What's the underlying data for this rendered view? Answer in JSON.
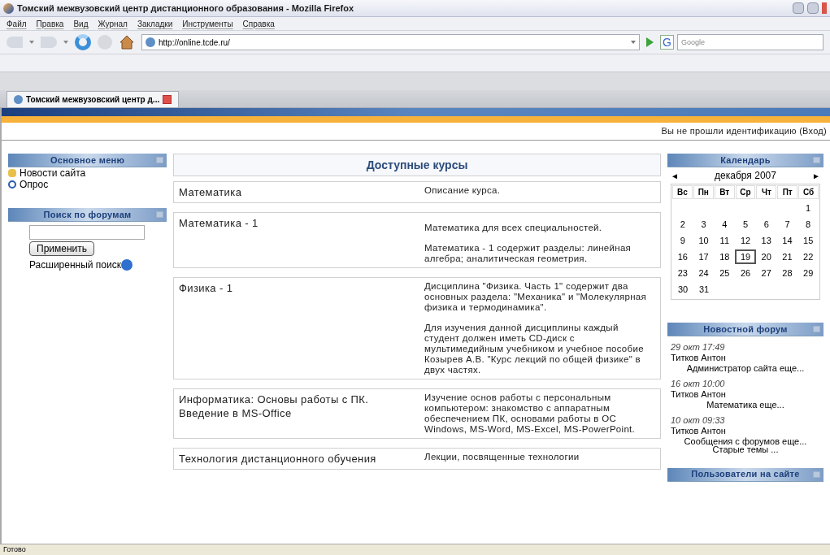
{
  "window": {
    "title": "Томский межвузовский центр дистанционного образования - Mozilla Firefox"
  },
  "menu": [
    "Файл",
    "Правка",
    "Вид",
    "Журнал",
    "Закладки",
    "Инструменты",
    "Справка"
  ],
  "address": {
    "value": "http://online.tcde.ru/"
  },
  "search": {
    "engine": "G",
    "placeholder": "Google"
  },
  "tabs": [
    {
      "label": "Томский межвузовский центр д...",
      "selected": true
    }
  ],
  "login_text": "Вы не прошли идентификацию (Вход)",
  "main_menu": {
    "title": "Основное меню",
    "items": [
      {
        "label": "Новости сайта",
        "kind": "news"
      },
      {
        "label": "Опрос",
        "kind": "poll"
      }
    ]
  },
  "forum_search": {
    "title": "Поиск по форумам",
    "button": "Применить",
    "advanced": "Расширенный поиск"
  },
  "courses": {
    "title": "Доступные курсы",
    "rows": [
      {
        "name": "Математика",
        "description": [
          "Описание курса."
        ]
      },
      {
        "name": "Математика - 1",
        "description": [
          "Математика для всех специальностей.",
          "Математика - 1 содержит разделы: линейная алгебра; аналитическая геометрия."
        ]
      },
      {
        "name": "Физика - 1",
        "description": [
          "Дисциплина \"Физика. Часть 1\" содержит два основных раздела: \"Механика\" и \"Молекулярная физика и термодинамика\".",
          "Для изучения данной дисциплины каждый студент должен иметь CD-диск с мультимедийным учебником и учебное пособие Козырев А.В. \"Курс лекций по общей физике\" в двух частях."
        ]
      },
      {
        "name": "Информатика: Основы работы с ПК. Введение в MS-Office",
        "description": [
          "Изучение основ работы с персональным компьютером: знакомство с аппаратным обеспечением ПК, основами работы в ОС Windows, MS-Word, MS-Excel, MS-PowerPoint."
        ]
      },
      {
        "name": "Технология дистанционного обучения",
        "description": [
          "Лекции, посвященные технологии"
        ]
      }
    ]
  },
  "calendar": {
    "title": "Календарь",
    "prev": "◄",
    "next": "►",
    "month": "декабря 2007",
    "weekdays": [
      "Вс",
      "Пн",
      "Вт",
      "Ср",
      "Чт",
      "Пт",
      "Сб"
    ],
    "weeks": [
      {
        "kind": "partial",
        "days": [
          {
            "day": "1",
            "today": false
          }
        ]
      },
      {
        "kind": "full",
        "days": [
          {
            "day": "2",
            "today": false
          },
          {
            "day": "3",
            "today": false
          },
          {
            "day": "4",
            "today": false
          },
          {
            "day": "5",
            "today": false
          },
          {
            "day": "6",
            "today": false
          },
          {
            "day": "7",
            "today": false
          },
          {
            "day": "8",
            "today": false
          }
        ]
      },
      {
        "kind": "full",
        "days": [
          {
            "day": "9",
            "today": false
          },
          {
            "day": "10",
            "today": false
          },
          {
            "day": "11",
            "today": false
          },
          {
            "day": "12",
            "today": false
          },
          {
            "day": "13",
            "today": false
          },
          {
            "day": "14",
            "today": false
          },
          {
            "day": "15",
            "today": false
          }
        ]
      },
      {
        "kind": "full",
        "days": [
          {
            "day": "16",
            "today": false
          },
          {
            "day": "17",
            "today": false
          },
          {
            "day": "18",
            "today": false
          },
          {
            "day": "19",
            "today": true
          },
          {
            "day": "20",
            "today": false
          },
          {
            "day": "21",
            "today": false
          },
          {
            "day": "22",
            "today": false
          }
        ]
      },
      {
        "kind": "full",
        "days": [
          {
            "day": "23",
            "today": false
          },
          {
            "day": "24",
            "today": false
          },
          {
            "day": "25",
            "today": false
          },
          {
            "day": "26",
            "today": false
          },
          {
            "day": "27",
            "today": false
          },
          {
            "day": "28",
            "today": false
          },
          {
            "day": "29",
            "today": false
          }
        ]
      },
      {
        "kind": "full",
        "days": [
          {
            "day": "30",
            "today": false
          },
          {
            "day": "31",
            "today": false
          }
        ]
      }
    ]
  },
  "news_forum": {
    "title": "Новостной форум",
    "posts": [
      {
        "date": "29 окт 17:49",
        "author": "Титков Антон",
        "link": "Администратор сайта еще..."
      },
      {
        "date": "16 окт 10:00",
        "author": "Титков Антон",
        "link": "Математика еще..."
      },
      {
        "date": "10 окт 09:33",
        "author": "Титков Антон",
        "link": "Сообщения с форумов еще..."
      }
    ],
    "old_topics": "Старые темы ..."
  },
  "online_users": {
    "title": "Пользователи на сайте"
  },
  "status_bar": "Готово"
}
